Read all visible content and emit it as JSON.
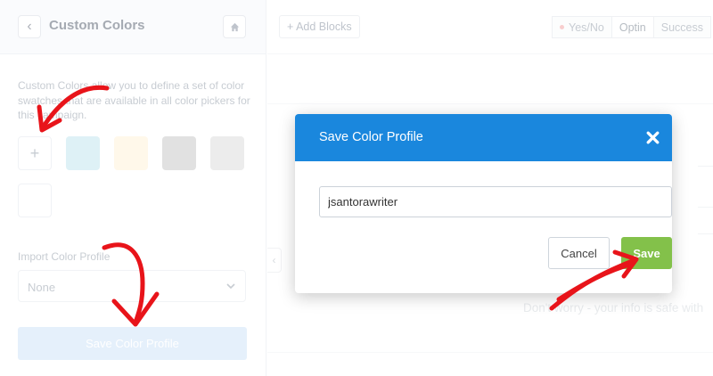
{
  "sidebar": {
    "title": "Custom Colors",
    "back_icon": "chevron-left-icon",
    "home_icon": "home-icon",
    "description": "Custom Colors allow you to define a set of color swatches that are available in all color pickers for this campaign.",
    "add_swatch_label": "+",
    "swatch_colors": [
      "#c3e6ee",
      "#fff3d9",
      "#c8c8c8",
      "#dcdcdc",
      "#ffffff"
    ],
    "import_label": "Import Color Profile",
    "import_value": "None",
    "save_profile_label": "Save Color Profile"
  },
  "topbar": {
    "add_blocks_label": "+ Add Blocks",
    "tabs": [
      {
        "label": "Yes/No",
        "active": false
      },
      {
        "label": "Optin",
        "active": true
      },
      {
        "label": "Success",
        "active": false
      }
    ]
  },
  "canvas": {
    "note": "Don't worry - your info is safe with"
  },
  "modal": {
    "title": "Save Color Profile",
    "close_icon": "close-icon",
    "input_value": "jsantorawriter",
    "cancel_label": "Cancel",
    "save_label": "Save",
    "header_color": "#1a87dd",
    "save_color": "#83c14a"
  },
  "annotations": {
    "arrow_color": "#e8141a"
  }
}
